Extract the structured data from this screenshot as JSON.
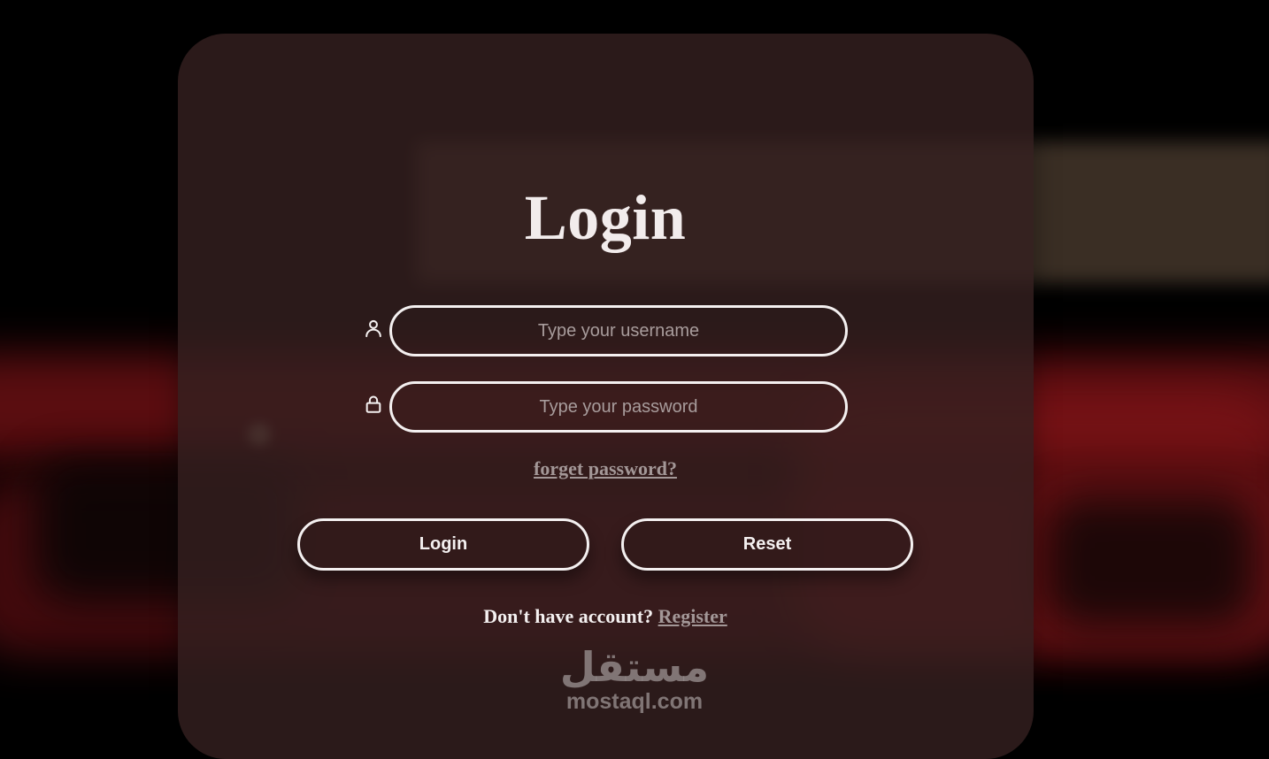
{
  "form": {
    "title": "Login",
    "username_placeholder": "Type your username",
    "password_placeholder": "Type your password",
    "forgot_password": "forget password?",
    "login_button": "Login",
    "reset_button": "Reset",
    "no_account_text": "Don't have account?",
    "register_link": "Register"
  },
  "icons": {
    "username": "user-icon",
    "password": "lock-icon"
  },
  "watermark": {
    "arabic": "مستقل",
    "site": "mostaql.com"
  },
  "colors": {
    "card": "#342020",
    "text": "#f4f0f0",
    "link": "#a39797"
  }
}
